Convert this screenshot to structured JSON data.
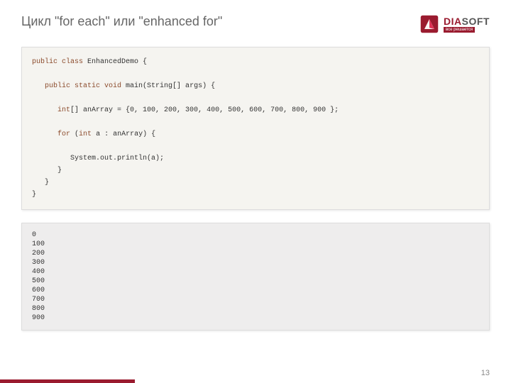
{
  "header": {
    "title": "Цикл \"for each\" или \"enhanced for\"",
    "logo": {
      "brand_dia": "DIA",
      "brand_soft": "SOFT",
      "tagline": "все решается"
    }
  },
  "code": {
    "l1_kw": "public class",
    "l1_rest": " EnhancedDemo {",
    "l2_kw": "public static void",
    "l2_rest": " main(String[] args) {",
    "l3_kw": "int",
    "l3_rest": "[] anArray = {0, 100, 200, 300, 400, 500, 600, 700, 800, 900 };",
    "l4_kw": "for",
    "l4_mid": " (",
    "l4_kw2": "int",
    "l4_rest": " a : anArray) {",
    "l5": "         System.out.println(a);",
    "l6": "      }",
    "l7": "   }",
    "l8": "}"
  },
  "output": "0\n100\n200\n300\n400\n500\n600\n700\n800\n900",
  "page_number": "13"
}
